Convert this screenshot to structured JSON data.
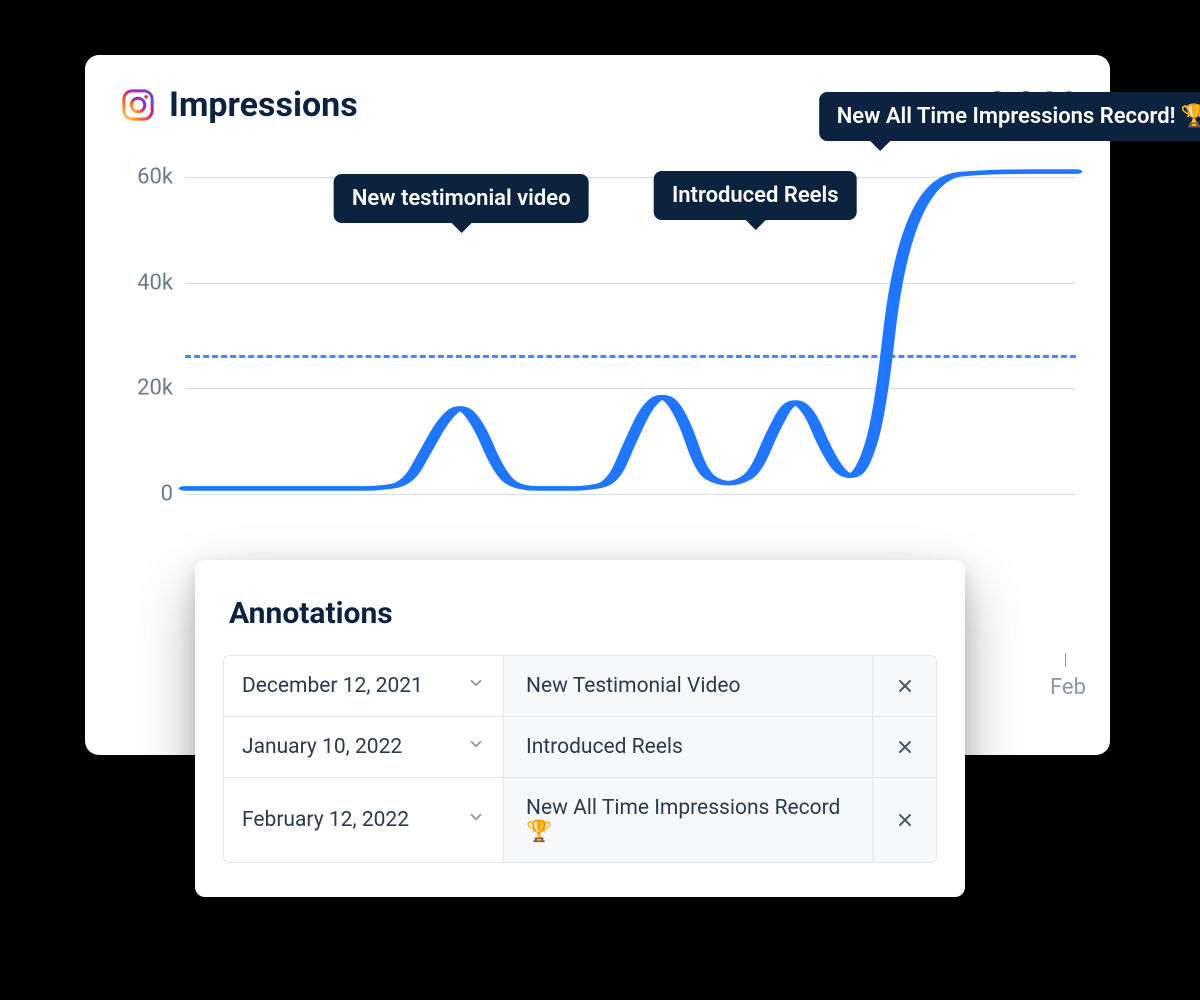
{
  "header": {
    "title": "Impressions",
    "metric": "2.2 M",
    "icon_name": "instagram-icon"
  },
  "callouts": {
    "c1": "New testimonial video",
    "c2": "Introduced Reels",
    "c3": "New All Time Impressions Record! 🏆"
  },
  "axes": {
    "y0": "0",
    "y20": "20k",
    "y40": "40k",
    "y60": "60k",
    "x_feb": "Feb"
  },
  "annotations_panel": {
    "title": "Annotations",
    "rows": [
      {
        "date": "December 12, 2021",
        "desc": "New Testimonial Video"
      },
      {
        "date": "January 10, 2022",
        "desc": "Introduced Reels"
      },
      {
        "date": "February 12, 2022",
        "desc": "New All Time Impressions Record 🏆"
      }
    ]
  },
  "chart_data": {
    "type": "line",
    "title": "Impressions",
    "ylabel": "Impressions",
    "xlabel": "",
    "ylim": [
      0,
      62
    ],
    "reference_line": 26,
    "x_tick_labels": {
      "89": "Feb"
    },
    "series": [
      {
        "name": "Impressions",
        "x_percent": [
          0,
          5,
          10,
          15,
          18,
          22,
          25,
          27,
          29,
          31,
          33,
          35,
          37,
          42,
          45,
          48,
          50,
          52,
          54,
          56,
          58,
          60,
          62,
          64,
          66,
          68,
          70,
          72,
          74,
          76,
          78,
          80,
          84,
          90,
          100
        ],
        "values": [
          1,
          1,
          1,
          1,
          1,
          1,
          2,
          8,
          14,
          17,
          13,
          5,
          1,
          1,
          1,
          2,
          10,
          17,
          19,
          14,
          4,
          2,
          2,
          4,
          12,
          18,
          16,
          8,
          3,
          4,
          15,
          45,
          60,
          61,
          61
        ]
      }
    ],
    "annotations": [
      {
        "x_percent": 31,
        "y": 17,
        "label": "New testimonial video"
      },
      {
        "x_percent": 67,
        "y": 18,
        "label": "Introduced Reels"
      },
      {
        "x_percent": 85,
        "y": 60,
        "label": "New All Time Impressions Record! 🏆"
      }
    ]
  }
}
